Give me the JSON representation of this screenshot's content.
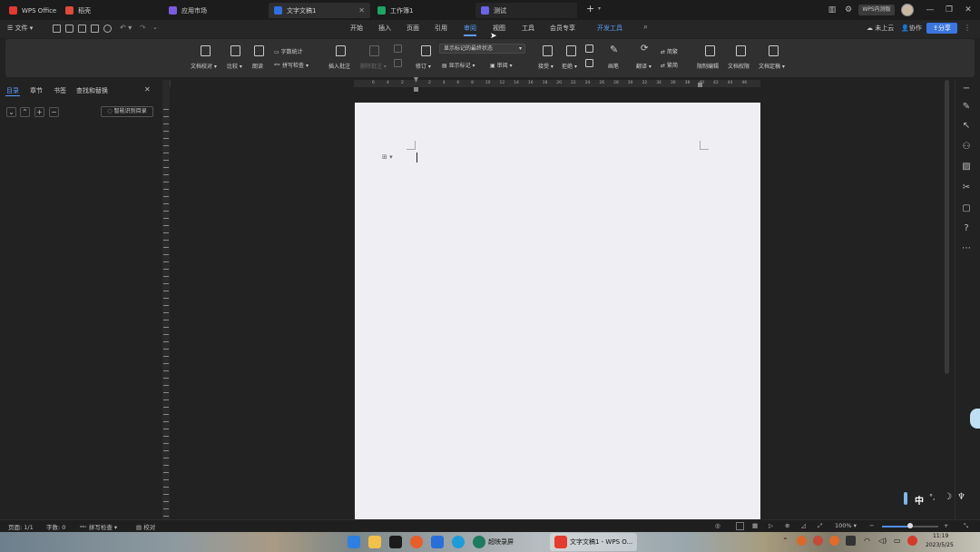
{
  "tabs": [
    {
      "label": "WPS Office",
      "color": "#e33b2e",
      "active": false
    },
    {
      "label": "稻壳",
      "color": "#e04a3c",
      "active": false
    },
    {
      "label": "应用市场",
      "color": "#7b5be0",
      "active": false
    },
    {
      "label": "文字文稿1",
      "color": "#2f6fe0",
      "active": true
    },
    {
      "label": "工作簿1",
      "color": "#1fa463",
      "active": false
    },
    {
      "label": "测试",
      "color": "#6c63e6",
      "active": false
    }
  ],
  "titlebar": {
    "new_tab": "+",
    "badge": "WPS内测版",
    "min": "—",
    "restore": "❐",
    "close": "✕"
  },
  "menubar": {
    "file_label": "文件",
    "items": [
      "开始",
      "插入",
      "页面",
      "引用",
      "审阅",
      "视图",
      "工具",
      "会员专享",
      "开发工具"
    ],
    "active": "审阅",
    "not_synced": "未上云",
    "collab": "协作",
    "share": "分享"
  },
  "ribbon": {
    "doc_proof": "文档校对",
    "compare": "比较",
    "read_aloud": "朗读",
    "word_count": "字数统计",
    "spell_check": "拼写检查",
    "insert_comment": "插入批注",
    "delete_comment": "删除批注",
    "track_changes": "修订",
    "markup_state": "显示标记的最终状态",
    "show_markup": "显示标记",
    "reviewer": "审阅",
    "accept": "接受",
    "reject": "拒绝",
    "ink": "画笔",
    "translate": "翻译",
    "simp": "简繁",
    "trad": "繁简",
    "restrict": "限制编辑",
    "doc_rights": "文档权限",
    "doc_finalize": "文档定稿"
  },
  "left_panel": {
    "tabs": [
      "目录",
      "章节",
      "书签",
      "查找和替换"
    ],
    "active": "目录",
    "close": "✕",
    "smart_toc": "智能识别目录"
  },
  "ruler": {
    "left_ticks": [
      "6",
      "4",
      "2"
    ],
    "right_ticks": [
      "2",
      "4",
      "6",
      "8",
      "10",
      "12",
      "14",
      "16",
      "18",
      "20",
      "22",
      "24",
      "26",
      "28",
      "30",
      "32",
      "34",
      "36",
      "38",
      "40",
      "42",
      "44",
      "46"
    ]
  },
  "statusbar": {
    "page": "页面: 1/1",
    "words": "字数: 0",
    "spell": "拼写检查",
    "proof": "校对",
    "zoom": "100%",
    "zoom_level": 0.5
  },
  "ime": {
    "lang": "中",
    "dots": "°,"
  },
  "taskbar": {
    "app1": "超映录屏",
    "app2": "文字文稿1 - WPS O...",
    "time": "11:19",
    "date": "2023/5/25"
  },
  "colors": {
    "accent": "#5b9cf5",
    "page": "#efeff3",
    "panel": "#222222",
    "ribbon": "#303030"
  }
}
